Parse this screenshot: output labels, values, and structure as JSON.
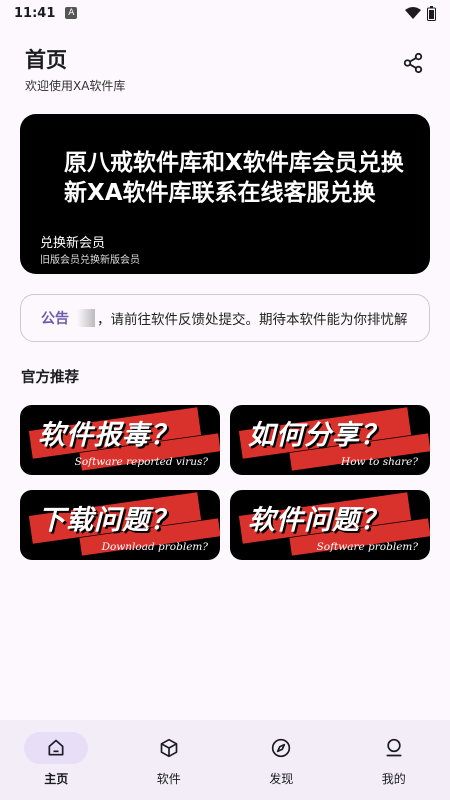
{
  "status_bar": {
    "time": "11:41",
    "notification": "A"
  },
  "header": {
    "title": "首页",
    "subtitle": "欢迎使用XA软件库"
  },
  "banner": {
    "headline": "原八戒软件库和X软件库会员兑换新XA软件库联系在线客服兑换",
    "title": "兑换新会员",
    "subtitle": "旧版会员兑换新版会员"
  },
  "notice": {
    "label": "公告",
    "text": "，请前往软件反馈处提交。期待本软件能为你排忧解"
  },
  "section": {
    "title": "官方推荐"
  },
  "cards": [
    {
      "big": "软件报毒？",
      "small": "Software reported virus?"
    },
    {
      "big": "如何分享？",
      "small": "How to share?"
    },
    {
      "big": "下载问题？",
      "small": "Download problem?"
    },
    {
      "big": "软件问题？",
      "small": "Software problem?"
    }
  ],
  "nav": [
    {
      "label": "主页",
      "icon": "home-icon",
      "active": true
    },
    {
      "label": "软件",
      "icon": "package-icon",
      "active": false
    },
    {
      "label": "发现",
      "icon": "compass-icon",
      "active": false
    },
    {
      "label": "我的",
      "icon": "person-icon",
      "active": false
    }
  ],
  "colors": {
    "accent": "#6d5cae",
    "nav_bg": "#f3edf7",
    "active_pill": "#e8def8",
    "stripe": "#d9312b"
  }
}
